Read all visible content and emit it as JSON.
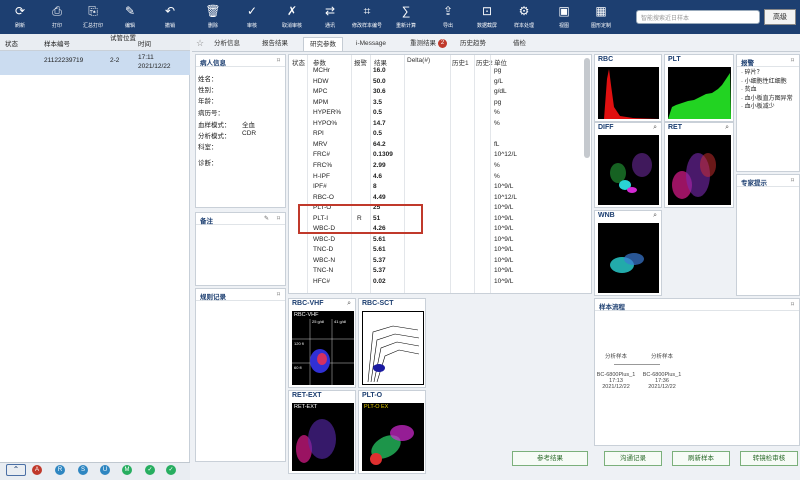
{
  "toolbar": {
    "items": [
      "刷新",
      "打印",
      "汇总打印",
      "编辑",
      "撤销",
      "删除",
      "审核",
      "取消审核",
      "通讯",
      "修改样本编号",
      "重新计算",
      "导出",
      "数据截屏",
      "样本处理",
      "视图",
      "图形定制"
    ],
    "search_placeholder": "智能搜索近日样本",
    "search_button": "高级"
  },
  "left": {
    "headers": [
      "状态",
      "样本编号",
      "试管位置",
      "时间"
    ],
    "row": {
      "sample_id": "21122239719",
      "position": "2-2",
      "time": "17:11\n2021/12/22"
    },
    "footer_icons": [
      "A",
      "R",
      "S",
      "U",
      "M",
      "✓"
    ]
  },
  "tabs": [
    "分析信息",
    "报告结果",
    "研究参数",
    "i-Message",
    "重测结果",
    "历史趋势",
    "借检"
  ],
  "tab_badge": "2",
  "patient": {
    "title": "病人信息",
    "fields": [
      "姓名：",
      "性别：",
      "年龄：",
      "病历号：",
      "血样模式：",
      "分析模式：",
      "科室：",
      "诊断："
    ],
    "blood_mode": "全血",
    "analysis_mode": "CDR"
  },
  "remarks": {
    "title": "备注"
  },
  "rules": {
    "title": "规则记录"
  },
  "table": {
    "headers": [
      "状态",
      "参数",
      "报警",
      "结果",
      "Delta(#)",
      "历史1",
      "历史2",
      "单位"
    ],
    "rows": [
      {
        "param": "MCHr",
        "flag": "",
        "result": "16.0",
        "unit": "pg"
      },
      {
        "param": "HDW",
        "flag": "",
        "result": "50.0",
        "unit": "g/L"
      },
      {
        "param": "MPC",
        "flag": "",
        "result": "30.6",
        "unit": "g/dL"
      },
      {
        "param": "MPM",
        "flag": "",
        "result": "3.5",
        "unit": "pg"
      },
      {
        "param": "HYPER%",
        "flag": "",
        "result": "0.5",
        "unit": "%"
      },
      {
        "param": "HYPO%",
        "flag": "",
        "result": "14.7",
        "unit": "%"
      },
      {
        "param": "RPI",
        "flag": "",
        "result": "0.5",
        "unit": ""
      },
      {
        "param": "MRV",
        "flag": "",
        "result": "64.2",
        "unit": "fL"
      },
      {
        "param": "FRC#",
        "flag": "",
        "result": "0.1309",
        "unit": "10^12/L"
      },
      {
        "param": "FRC%",
        "flag": "",
        "result": "2.99",
        "unit": "%"
      },
      {
        "param": "H-IPF",
        "flag": "",
        "result": "4.6",
        "unit": "%"
      },
      {
        "param": "IPF#",
        "flag": "",
        "result": "8",
        "unit": "10^9/L"
      },
      {
        "param": "RBC-O",
        "flag": "",
        "result": "4.49",
        "unit": "10^12/L"
      },
      {
        "param": "PLT-O",
        "flag": "",
        "result": "25",
        "unit": "10^9/L"
      },
      {
        "param": "PLT-I",
        "flag": "R",
        "result": "51",
        "unit": "10^9/L"
      },
      {
        "param": "WBC-D",
        "flag": "",
        "result": "4.26",
        "unit": "10^9/L"
      },
      {
        "param": "WBC-D",
        "flag": "",
        "result": "5.61",
        "unit": "10^9/L"
      },
      {
        "param": "TNC-D",
        "flag": "",
        "result": "5.61",
        "unit": "10^9/L"
      },
      {
        "param": "WBC-N",
        "flag": "",
        "result": "5.37",
        "unit": "10^9/L"
      },
      {
        "param": "TNC-N",
        "flag": "",
        "result": "5.37",
        "unit": "10^9/L"
      },
      {
        "param": "HFC#",
        "flag": "",
        "result": "0.02",
        "unit": "10^9/L"
      }
    ]
  },
  "charts": {
    "rbc": "RBC",
    "plt": "PLT",
    "diff": "DIFF",
    "ret": "RET",
    "wnb": "WNB",
    "rbc_vhf": "RBC-VHF",
    "rbc_sct": "RBC-SCT",
    "ret_ext": "RET-EXT",
    "plt_o": "PLT-O",
    "plt_o_inner": "PLT-O EX",
    "vhf_labels": [
      "25 g/dl",
      "41 g/dl",
      "120 fl",
      "60 fl"
    ]
  },
  "alarm": {
    "title": "报警",
    "items": [
      "· 碎片？",
      "· 小细胞性红细胞",
      "· 贫血",
      "· 血小板直方图异常",
      "· 血小板减少"
    ]
  },
  "expert": {
    "title": "专家提示"
  },
  "flow": {
    "title": "样本流程",
    "steps": [
      {
        "name": "分析样本",
        "device": "BC-6800Plus_1",
        "time": "17:13",
        "date": "2021/12/22"
      },
      {
        "name": "分析样本",
        "device": "BC-6800Plus_1",
        "time": "17:36",
        "date": "2021/12/22"
      }
    ]
  },
  "buttons": {
    "ref": "参考结果",
    "comm": "沟通记录",
    "refresh": "刷新样本",
    "retest": "转镜检审核"
  }
}
